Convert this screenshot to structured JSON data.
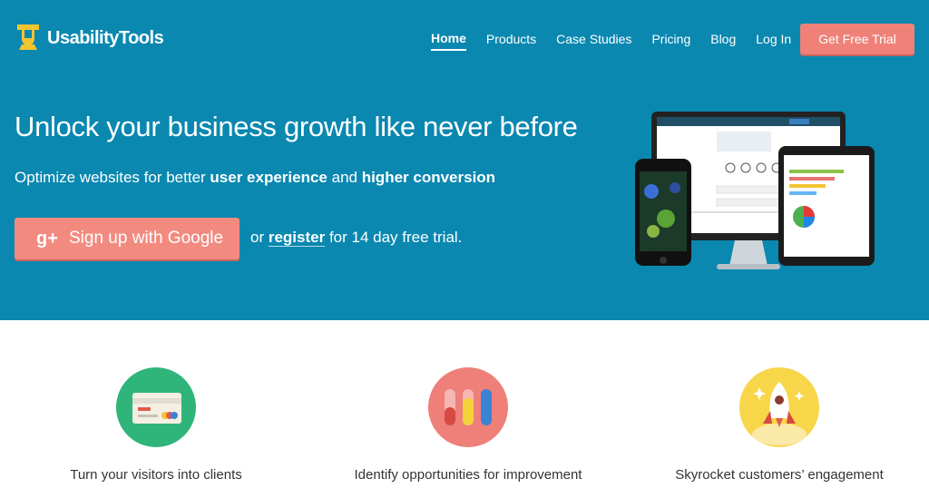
{
  "brand": {
    "name": "UsabilityTools",
    "logo_glyph": "U"
  },
  "nav": {
    "items": [
      {
        "label": "Home",
        "active": true
      },
      {
        "label": "Products",
        "active": false
      },
      {
        "label": "Case Studies",
        "active": false
      },
      {
        "label": "Pricing",
        "active": false
      },
      {
        "label": "Blog",
        "active": false
      },
      {
        "label": "Log In",
        "active": false
      }
    ],
    "cta_label": "Get Free Trial"
  },
  "hero": {
    "headline": "Unlock your business growth like never before",
    "sub_prefix": "Optimize websites for better ",
    "sub_bold1": "user experience",
    "sub_mid": " and ",
    "sub_bold2": "higher conversion",
    "google_icon": "g+",
    "google_label": "Sign up with Google",
    "trial_prefix": "or ",
    "trial_link": "register",
    "trial_suffix": " for 14 day free trial."
  },
  "features": [
    {
      "caption": "Turn your visitors into clients",
      "icon": "credit-card-icon",
      "color": "#2fb57a"
    },
    {
      "caption": "Identify opportunities for improvement",
      "icon": "bars-icon",
      "color": "#ef7f79"
    },
    {
      "caption": "Skyrocket customers’ engagement",
      "icon": "rocket-icon",
      "color": "#f7d64a"
    }
  ],
  "colors": {
    "hero_bg": "#0a88b0",
    "cta": "#ef8178"
  }
}
